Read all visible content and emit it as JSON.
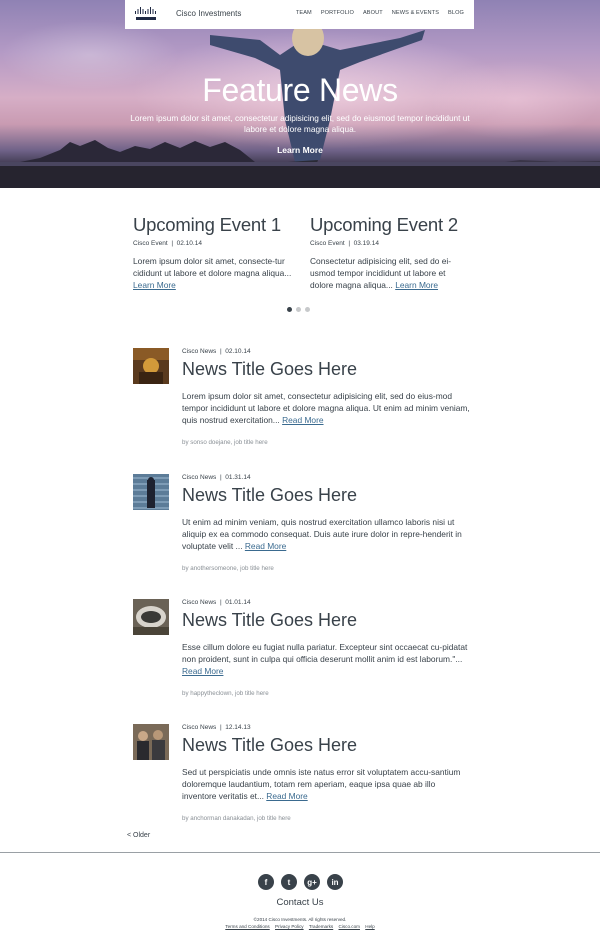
{
  "nav": {
    "brand": "Cisco Investments",
    "links": [
      "TEAM",
      "PORTFOLIO",
      "ABOUT",
      "NEWS & EVENTS",
      "BLOG"
    ]
  },
  "hero": {
    "title": "Feature News",
    "subtitle": "Lorem ipsum dolor sit amet, consectetur adipisicing elit, sed do eiusmod tempor incididunt ut labore et dolore magna aliqua.",
    "button": "Learn More"
  },
  "events": [
    {
      "title": "Upcoming Event 1",
      "source": "Cisco Event",
      "sep": "|",
      "date": "02.10.14",
      "text": "Lorem ipsum dolor sit amet, consecte-tur cididunt ut labore et dolore magna aliqua...",
      "link": "Learn More"
    },
    {
      "title": "Upcoming Event 2",
      "source": "Cisco Event",
      "sep": "|",
      "date": "03.19.14",
      "text": "Consectetur adipisicing elit, sed do ei-usmod tempor incididunt ut labore et dolore magna aliqua...",
      "link": "Learn More"
    }
  ],
  "carousel": {
    "count": 3,
    "active": 0
  },
  "news": [
    {
      "source": "Cisco News",
      "sep": "|",
      "date": "02.10.14",
      "title": "News Title Goes Here",
      "text": "Lorem ipsum dolor sit amet, consectetur adipisicing elit, sed do eius-mod tempor incididunt ut labore et dolore magna aliqua. Ut enim ad minim veniam, quis nostrud exercitation...",
      "link": "Read More",
      "byline": "by sonso doejane, job title here"
    },
    {
      "source": "Cisco News",
      "sep": "|",
      "date": "01.31.14",
      "title": "News Title Goes Here",
      "text": "Ut enim ad minim veniam, quis nostrud exercitation ullamco laboris nisi ut aliquip ex ea commodo consequat. Duis aute irure dolor in repre-henderit in voluptate velit ...",
      "link": "Read More",
      "byline": "by anothersomeone, job title here"
    },
    {
      "source": "Cisco News",
      "sep": "|",
      "date": "01.01.14",
      "title": "News Title Goes Here",
      "text": "Esse cillum dolore eu fugiat nulla pariatur. Excepteur sint occaecat cu-pidatat non proident, sunt in culpa qui officia deserunt mollit anim id est laborum.\"...",
      "link": "Read More",
      "byline": "by happytheclown, job title here"
    },
    {
      "source": "Cisco News",
      "sep": "|",
      "date": "12.14.13",
      "title": "News Title Goes Here",
      "text": "Sed ut perspiciatis unde omnis iste natus error sit voluptatem accu-santium doloremque laudantium, totam rem aperiam, eaque ipsa quae ab illo inventore veritatis et...",
      "link": "Read More",
      "byline": "by anchorman danakadan, job title here"
    }
  ],
  "pagination": {
    "older": "< Older"
  },
  "footer": {
    "social": [
      {
        "icon": "facebook-icon",
        "glyph": "f"
      },
      {
        "icon": "twitter-icon",
        "glyph": "t"
      },
      {
        "icon": "googleplus-icon",
        "glyph": "g+"
      },
      {
        "icon": "linkedin-icon",
        "glyph": "in"
      }
    ],
    "contact": "Contact Us",
    "copyright": "©2014 Cisco Investments. All rights reserved.",
    "legal": [
      "Terms and Conditions",
      "Privacy Policy",
      "Trademarks",
      "Cisco.com",
      "Help"
    ]
  },
  "colors": {
    "text": "#39424a",
    "link": "#3a6a8f",
    "hero_sky": "#b49ac5"
  }
}
